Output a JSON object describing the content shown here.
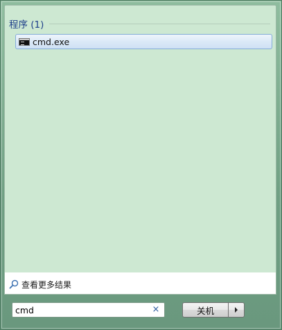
{
  "results": {
    "group_title": "程序 (1)",
    "items": [
      {
        "label": "cmd.exe",
        "icon": "cmd-icon"
      }
    ],
    "more_results_label": "查看更多结果"
  },
  "search": {
    "value": "cmd",
    "placeholder": "",
    "clear_glyph": "×"
  },
  "shutdown": {
    "label": "关机",
    "menu_icon": "right-arrow-icon"
  },
  "colors": {
    "results_background": "#cde8d2",
    "group_title": "#1e3f8a",
    "selected_item_border": "#84acd6",
    "frame": "#7fa890"
  }
}
